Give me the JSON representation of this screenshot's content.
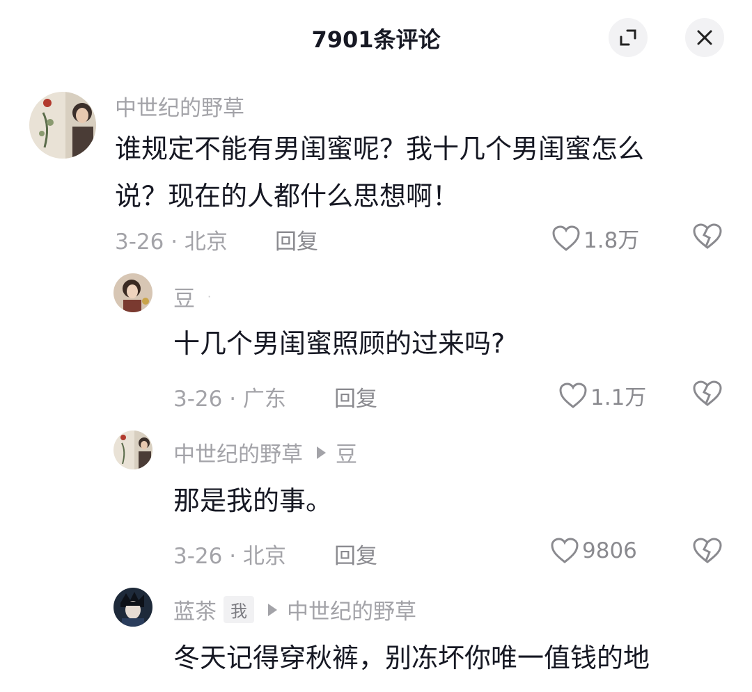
{
  "header": {
    "title": "7901条评论",
    "expand_icon": "expand-icon",
    "close_icon": "close-icon"
  },
  "comments": [
    {
      "username": "中世纪的野草",
      "text_line1": "谁规定不能有男闺蜜呢？我十几个男闺蜜怎么",
      "text_line2": "说？现在的人都什么思想啊！",
      "date_location": "3-26 · 北京",
      "reply_label": "回复",
      "likes": "1.8万"
    },
    {
      "username": "豆",
      "dot": "·",
      "text": "十几个男闺蜜照顾的过来吗?",
      "date_location": "3-26 · 广东",
      "reply_label": "回复",
      "likes": "1.1万"
    },
    {
      "username": "中世纪的野草",
      "reply_to": "豆",
      "text": "那是我的事。",
      "date_location": "3-26 · 北京",
      "reply_label": "回复",
      "likes": "9806"
    },
    {
      "username": "蓝茶",
      "tag": "我",
      "reply_to": "中世纪的野草",
      "text": "冬天记得穿秋裤，别冻坏你唯一值钱的地"
    }
  ],
  "colors": {
    "text_primary": "#161823",
    "text_secondary": "#a3a3a8",
    "button_bg": "#f2f2f4"
  }
}
